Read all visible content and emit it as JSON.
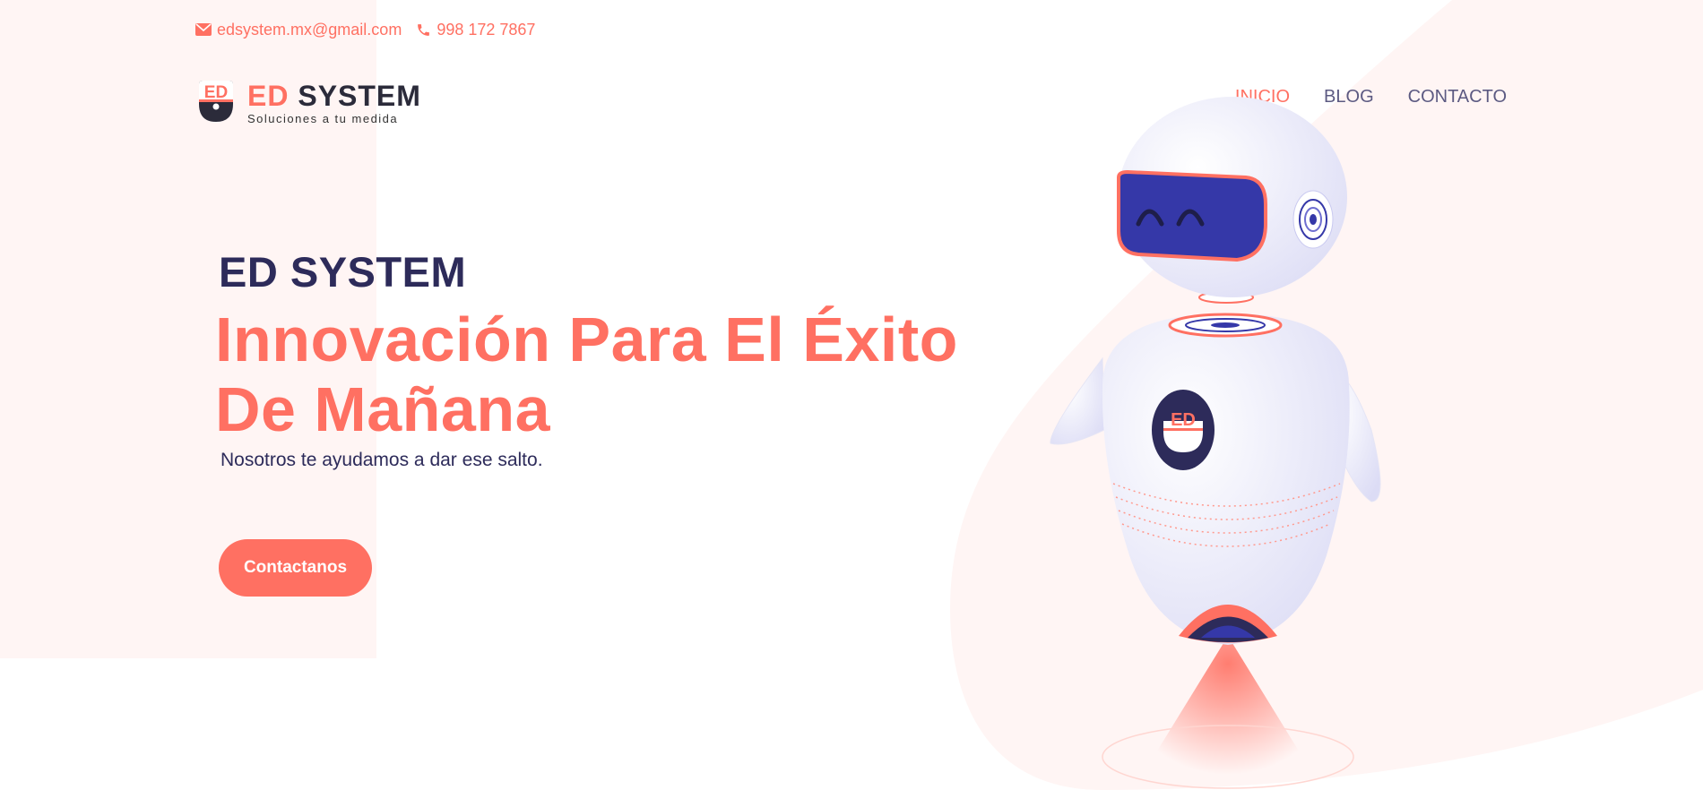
{
  "topbar": {
    "email": "edsystem.mx@gmail.com",
    "phone": "998 172 7867",
    "email_icon": "envelope-icon",
    "phone_icon": "phone-icon"
  },
  "logo": {
    "brand_part1": "ED",
    "brand_part2": "SYSTEM",
    "tagline": "Soluciones a tu medida",
    "mark_text": "ED"
  },
  "nav": {
    "items": [
      {
        "label": "INICIO",
        "active": true
      },
      {
        "label": "BLOG",
        "active": false
      },
      {
        "label": "CONTACTO",
        "active": false
      }
    ]
  },
  "hero": {
    "kicker": "ED SYSTEM",
    "title_line1": "Innovación Para El Éxito",
    "title_line2": "De Mañana",
    "subtitle": "Nosotros te ayudamos a dar ese salto.",
    "cta_label": "Contactanos"
  },
  "robot": {
    "badge_text": "ED"
  },
  "colors": {
    "accent": "#ff7062",
    "navy": "#2d2b5a",
    "nav_text": "#5c5a82",
    "robot_visor": "#3538a8",
    "soft_bg": "#fff5f4"
  }
}
